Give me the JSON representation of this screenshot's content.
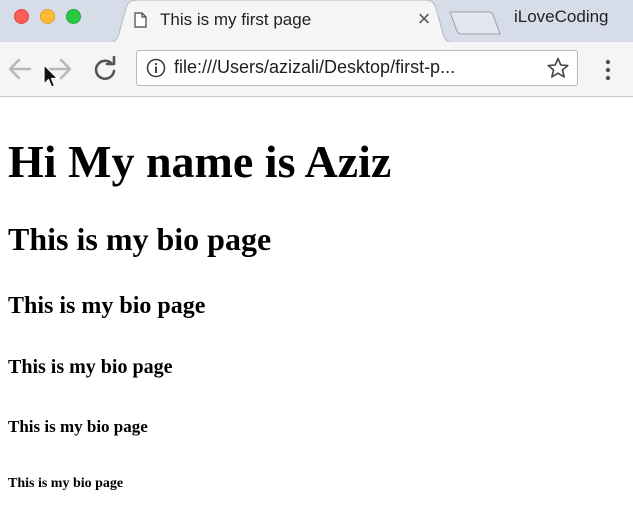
{
  "window": {
    "controls": [
      "close-button",
      "minimize-button",
      "maximize-button"
    ]
  },
  "tab": {
    "title": "This is my first page",
    "close_label": "×",
    "icon": "page-icon"
  },
  "profile": {
    "label": "iLoveCoding"
  },
  "toolbar": {
    "back_icon": "arrow-left-icon",
    "forward_icon": "arrow-right-icon",
    "reload_icon": "reload-icon",
    "info_icon": "info-icon",
    "url": "file:///Users/azizali/Desktop/first-p...",
    "bookmark_icon": "star-icon",
    "menu_icon": "kebab-menu-icon"
  },
  "page": {
    "h1": "Hi My name is Aziz",
    "h2": "This is my bio page",
    "h3": "This is my bio page",
    "h4": "This is my bio page",
    "h5": "This is my bio page",
    "h6": "This is my bio page"
  },
  "colors": {
    "tabstrip_bg": "#d6dde8",
    "toolbar_bg": "#f5f5f5",
    "close": "#fc5f57",
    "minimize": "#fdbd2f",
    "maximize": "#29c940"
  }
}
